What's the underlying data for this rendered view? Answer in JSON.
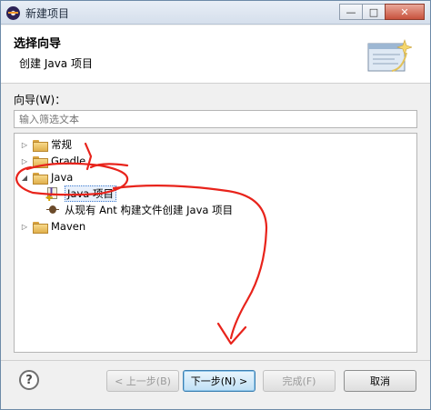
{
  "window": {
    "title": "新建项目",
    "controls": {
      "minimize": "—",
      "maximize": "□",
      "close": "✕"
    }
  },
  "header": {
    "title": "选择向导",
    "description": "创建 Java 项目",
    "icon": "wizard-banner-icon"
  },
  "wizard_label": "向导(W)：",
  "filter": {
    "placeholder": "输入筛选文本",
    "value": ""
  },
  "tree": {
    "nodes": [
      {
        "label": "常规",
        "expanded": false,
        "icon": "folder-icon"
      },
      {
        "label": "Gradle",
        "expanded": false,
        "icon": "folder-icon"
      },
      {
        "label": "Java",
        "expanded": true,
        "icon": "folder-icon"
      },
      {
        "label": "Java 项目",
        "selected": true,
        "icon": "java-project-icon"
      },
      {
        "label": "从现有 Ant 构建文件创建 Java 项目",
        "icon": "ant-icon"
      },
      {
        "label": "Maven",
        "expanded": false,
        "icon": "folder-icon"
      }
    ]
  },
  "footer": {
    "help": "?",
    "back": "< 上一步(B)",
    "next": "下一步(N) >",
    "finish": "完成(F)",
    "cancel": "取消"
  },
  "colors": {
    "annotation": "#e8231b",
    "selection_border": "#3d7bd0",
    "primary_button": "#3c7fb1"
  }
}
